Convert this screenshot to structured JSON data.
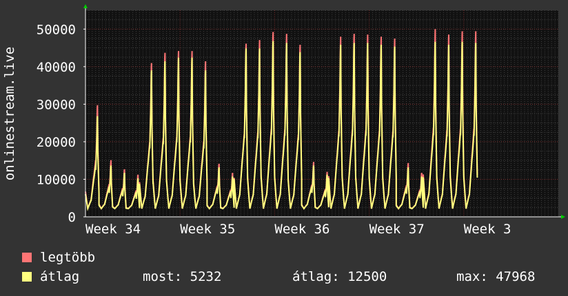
{
  "chart_data": {
    "type": "area",
    "ylabel": "onlinestream.live",
    "ylim": [
      0,
      55000
    ],
    "yticks": [
      0,
      10000,
      20000,
      30000,
      40000,
      50000
    ],
    "ytick_labels": [
      "0",
      "10000",
      "20000",
      "30000",
      "40000",
      "50000"
    ],
    "x_tick_labels": [
      "Week 34",
      "Week 35",
      "Week 36",
      "Week 37",
      "Week 3"
    ],
    "x_range_days": [
      0,
      35
    ],
    "x_tick_days": [
      0,
      7,
      14,
      21,
      28
    ],
    "grid": true,
    "colors": {
      "background": "#333333",
      "plot_background": "#111111",
      "grid": "#404040",
      "major_grid": "#7a2a2a",
      "axis": "#ffffff",
      "max_series": "#ff7575",
      "avg_series": "#ffff7f"
    },
    "daily_peaks": [
      {
        "max": 30500,
        "avg": 27500
      },
      {
        "max": 15500,
        "avg": 14000
      },
      {
        "max": 13000,
        "avg": 12000
      },
      {
        "max": 11500,
        "avg": 10500
      },
      {
        "max": 42000,
        "avg": 40000
      },
      {
        "max": 44800,
        "avg": 42500
      },
      {
        "max": 45300,
        "avg": 43500
      },
      {
        "max": 45300,
        "avg": 43500
      },
      {
        "max": 42500,
        "avg": 40000
      },
      {
        "max": 14500,
        "avg": 13500
      },
      {
        "max": 12000,
        "avg": 11000
      },
      {
        "max": 47300,
        "avg": 46000
      },
      {
        "max": 48300,
        "avg": 46000
      },
      {
        "max": 50500,
        "avg": 48000
      },
      {
        "max": 50000,
        "avg": 47500
      },
      {
        "max": 47000,
        "avg": 45000
      },
      {
        "max": 15000,
        "avg": 14000
      },
      {
        "max": 12300,
        "avg": 11500
      },
      {
        "max": 49200,
        "avg": 47000
      },
      {
        "max": 50000,
        "avg": 47500
      },
      {
        "max": 49800,
        "avg": 47500
      },
      {
        "max": 49200,
        "avg": 47000
      },
      {
        "max": 48700,
        "avg": 46500
      },
      {
        "max": 14700,
        "avg": 13500
      },
      {
        "max": 12000,
        "avg": 11000
      },
      {
        "max": 51300,
        "avg": 47800
      },
      {
        "max": 49800,
        "avg": 47000
      },
      {
        "max": 50700,
        "avg": 47800
      },
      {
        "max": 50700,
        "avg": 47500
      }
    ],
    "series": [
      {
        "name": "legtöbb",
        "color": "#ff7575"
      },
      {
        "name": "átlag",
        "color": "#ffff7f"
      }
    ],
    "gap_day_range": [
      15.9,
      16.1
    ]
  },
  "legend": {
    "max_label": "legtöbb",
    "avg_label": "átlag",
    "now_text": "most: 5232",
    "avg_text": "átlag: 12500",
    "max_text": "max: 47968"
  }
}
